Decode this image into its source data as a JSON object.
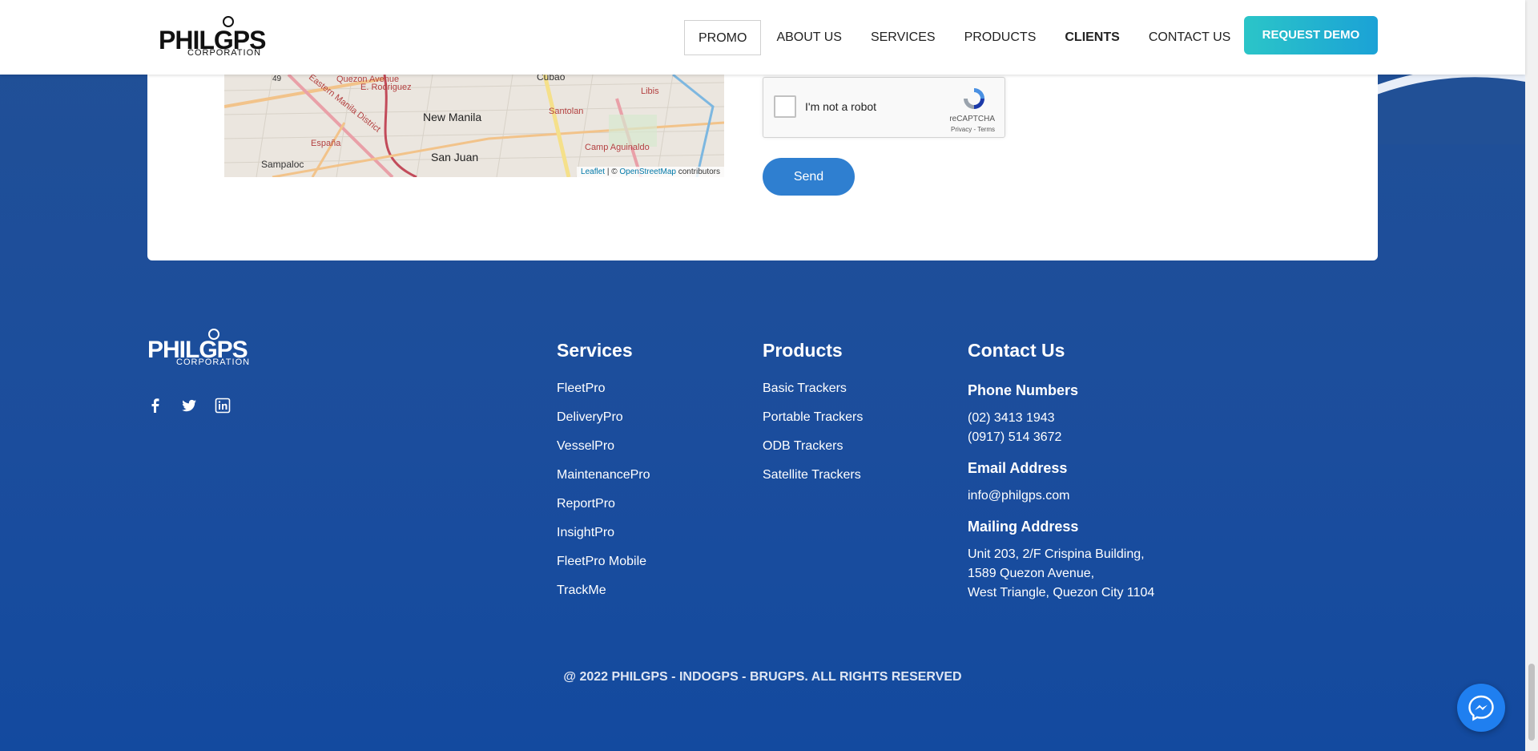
{
  "header": {
    "logo_text": "PHILGPS",
    "logo_sub": "CORPORATION",
    "nav": [
      {
        "label": "PROMO"
      },
      {
        "label": "ABOUT US"
      },
      {
        "label": "SERVICES"
      },
      {
        "label": "PRODUCTS"
      },
      {
        "label": "CLIENTS"
      },
      {
        "label": "CONTACT US"
      }
    ],
    "demo_label": "REQUEST DEMO"
  },
  "map": {
    "labels": [
      "Quezon Avenue",
      "E. Rodriguez",
      "Eastern Manila District",
      "New Manila",
      "San Juan",
      "Sampaloc",
      "España",
      "Santolan",
      "Camp Aguinaldo",
      "Libis",
      "Cubao",
      "49"
    ],
    "attribution_leaflet": "Leaflet",
    "attribution_sep": " | © ",
    "attribution_osm": "OpenStreetMap",
    "attribution_tail": " contributors"
  },
  "recaptcha": {
    "label": "I'm not a robot",
    "brand": "reCAPTCHA",
    "terms": "Privacy - Terms"
  },
  "form": {
    "send_label": "Send"
  },
  "footer": {
    "logo_text": "PHILGPS",
    "logo_sub": "CORPORATION",
    "social": [
      "facebook-icon",
      "twitter-icon",
      "linkedin-icon"
    ],
    "services": {
      "title": "Services",
      "items": [
        "FleetPro",
        "DeliveryPro",
        "VesselPro",
        "MaintenancePro",
        "ReportPro",
        "InsightPro",
        "FleetPro Mobile",
        "TrackMe"
      ]
    },
    "products": {
      "title": "Products",
      "items": [
        "Basic Trackers",
        "Portable Trackers",
        "ODB Trackers",
        "Satellite Trackers"
      ]
    },
    "contact": {
      "title": "Contact Us",
      "phone_title": "Phone Numbers",
      "phones": [
        "(02) 3413 1943",
        "(0917) 514 3672"
      ],
      "email_title": "Email Address",
      "email": "info@philgps.com",
      "mail_title": "Mailing Address",
      "address": [
        "Unit 203, 2/F Crispina Building,",
        "1589 Quezon Avenue,",
        "West Triangle, Quezon City 1104"
      ]
    },
    "copyright": "@ 2022 PHILGPS - INDOGPS - BRUGPS. ALL RIGHTS RESERVED"
  },
  "colors": {
    "footer_bg": "#1c4c9e",
    "demo_gradient_start": "#2bc5c8",
    "demo_gradient_end": "#1ba2d6",
    "send_button": "#2f7fd0",
    "messenger": "#1f7ff0"
  }
}
